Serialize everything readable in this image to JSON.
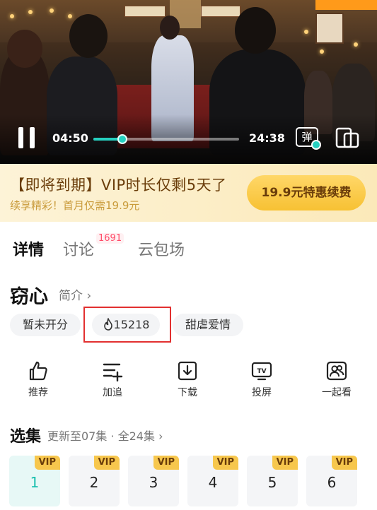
{
  "player": {
    "current_time": "04:50",
    "total_time": "24:38",
    "progress_fraction": 0.197,
    "danmu_label": "弹"
  },
  "vip_banner": {
    "title": "【即将到期】VIP时长仅剩5天了",
    "subtitle": "续享精彩！首月仅需19.9元",
    "button": "19.9元特惠续费"
  },
  "tabs": [
    {
      "label": "详情",
      "active": true
    },
    {
      "label": "讨论",
      "badge": "1691"
    },
    {
      "label": "云包场"
    }
  ],
  "show": {
    "title": "窃心",
    "intro_link": "简介 ›",
    "tags": {
      "rating": "暂未开分",
      "heat": "15218",
      "genre": "甜虐爱情"
    }
  },
  "actions": [
    {
      "label": "推荐",
      "icon": "thumbs-up-icon"
    },
    {
      "label": "加追",
      "icon": "add-list-icon"
    },
    {
      "label": "下载",
      "icon": "download-icon"
    },
    {
      "label": "投屏",
      "icon": "tv-cast-icon"
    },
    {
      "label": "一起看",
      "icon": "watch-together-icon"
    }
  ],
  "episodes": {
    "title": "选集",
    "info": "更新至07集 · 全24集 ›",
    "vip_label": "VIP",
    "items": [
      "1",
      "2",
      "3",
      "4",
      "5",
      "6"
    ],
    "active_index": 0
  },
  "colors": {
    "accent": "#26d0c0",
    "vip_gold": "#f7c74d",
    "banner_text": "#6a3d0a",
    "highlight_red": "#e23030"
  }
}
